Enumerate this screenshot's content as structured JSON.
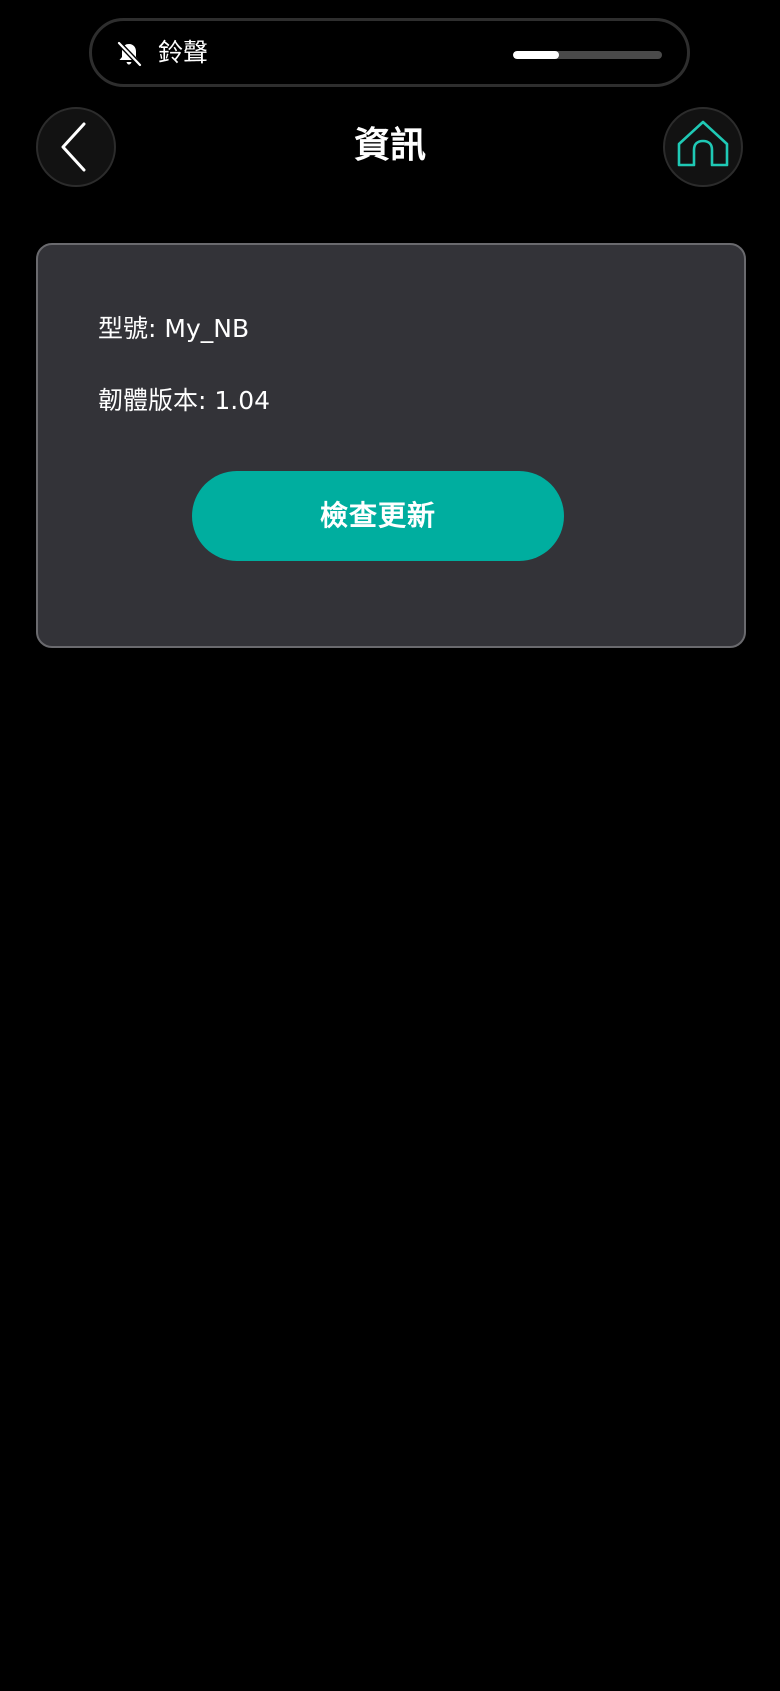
{
  "ringer": {
    "label": "鈴聲",
    "icon": "bell-muted-icon",
    "volume_fraction": 0.31
  },
  "header": {
    "title": "資訊",
    "back_icon": "chevron-left-icon",
    "home_icon": "home-icon"
  },
  "info": {
    "model_label": "型號",
    "model_value": "My_NB",
    "firmware_label": "韌體版本",
    "firmware_value": "1.04",
    "check_update_label": "檢查更新"
  },
  "colors": {
    "accent": "#00ae9f",
    "home_icon": "#1fc9b5",
    "card_bg": "#333338",
    "background": "#000000"
  }
}
